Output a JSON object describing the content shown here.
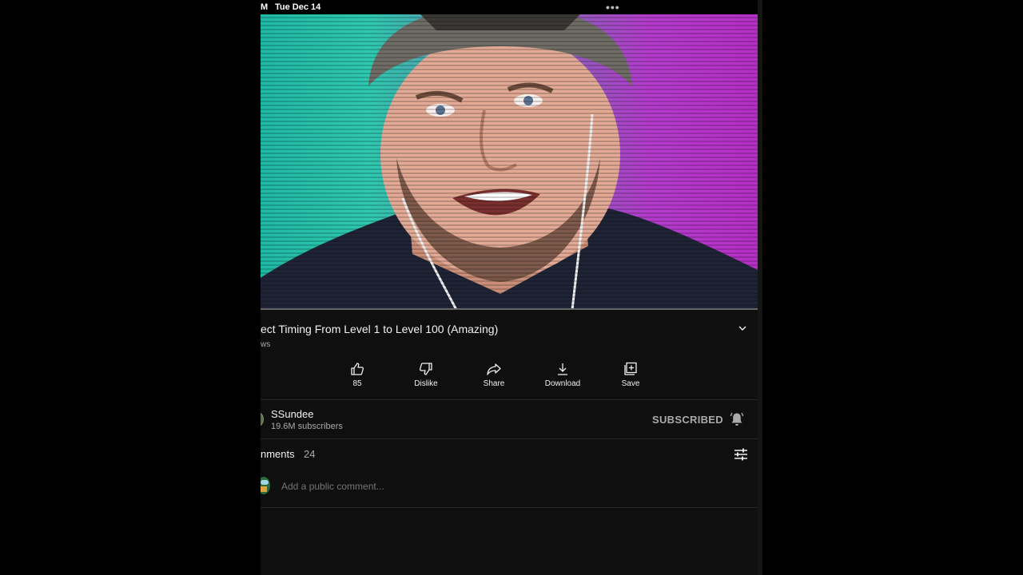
{
  "status_bar": {
    "time": "M",
    "date": "Tue Dec 14",
    "multitask_dots": "•••"
  },
  "video": {
    "title": "ect Timing From Level 1 to Level 100 (Amazing)",
    "views": "ws"
  },
  "actions": [
    {
      "label": "85",
      "icon": "thumbs-up-icon"
    },
    {
      "label": "Dislike",
      "icon": "thumbs-down-icon"
    },
    {
      "label": "Share",
      "icon": "share-icon"
    },
    {
      "label": "Download",
      "icon": "download-icon"
    },
    {
      "label": "Save",
      "icon": "save-playlist-icon"
    }
  ],
  "channel": {
    "name": "SSundee",
    "subscribers": "19.6M subscribers",
    "subscribe_state": "SUBSCRIBED"
  },
  "comments": {
    "label": "nments",
    "count": "24",
    "placeholder": "Add a public comment..."
  },
  "colors": {
    "background": "#0f0f0f",
    "text_primary": "#f1f1f1",
    "text_secondary": "#aaaaaa",
    "divider": "#272727",
    "video_left": "#2ec9b0",
    "video_right": "#b52fc5"
  }
}
